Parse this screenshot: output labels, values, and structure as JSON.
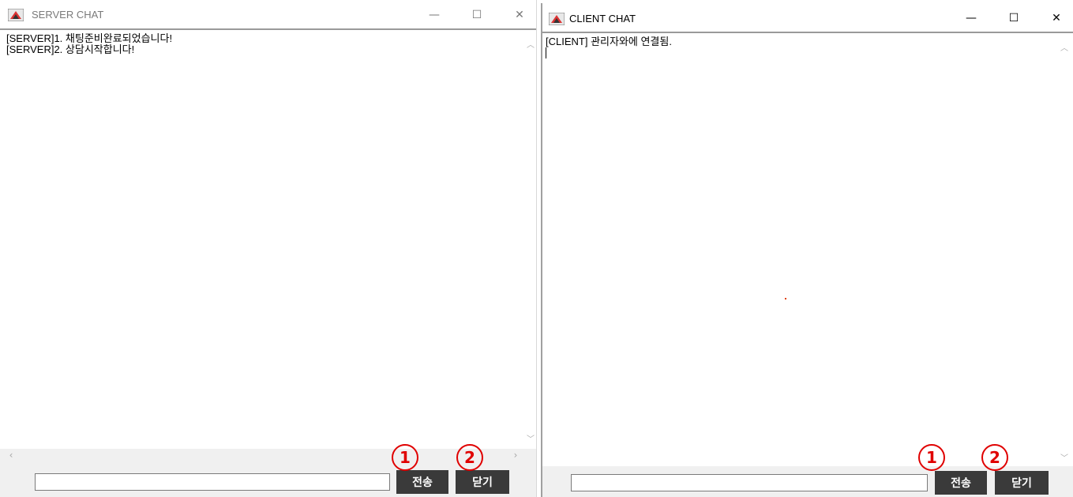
{
  "colors": {
    "button_bg": "#3a3a3a",
    "button_text": "#ffffff",
    "marker": "#e00000",
    "bottom_bar": "#f0f0f0"
  },
  "server": {
    "title": "SERVER CHAT",
    "icon": "java-app-icon",
    "messages": [
      "[SERVER]1. 채팅준비완료되었습니다!",
      "[SERVER]2. 상담시작합니다!"
    ],
    "input_value": "",
    "send_label": "전송",
    "close_label": "닫기",
    "markers": {
      "send": "1",
      "close": "2"
    }
  },
  "client": {
    "title": "CLIENT CHAT",
    "icon": "java-app-icon",
    "messages": [
      "[CLIENT] 관리자와에 연결됨."
    ],
    "input_value": "",
    "send_label": "전송",
    "close_label": "닫기",
    "markers": {
      "send": "1",
      "close": "2"
    }
  },
  "window_controls": {
    "minimize": "—",
    "maximize": "☐",
    "close": "✕"
  }
}
